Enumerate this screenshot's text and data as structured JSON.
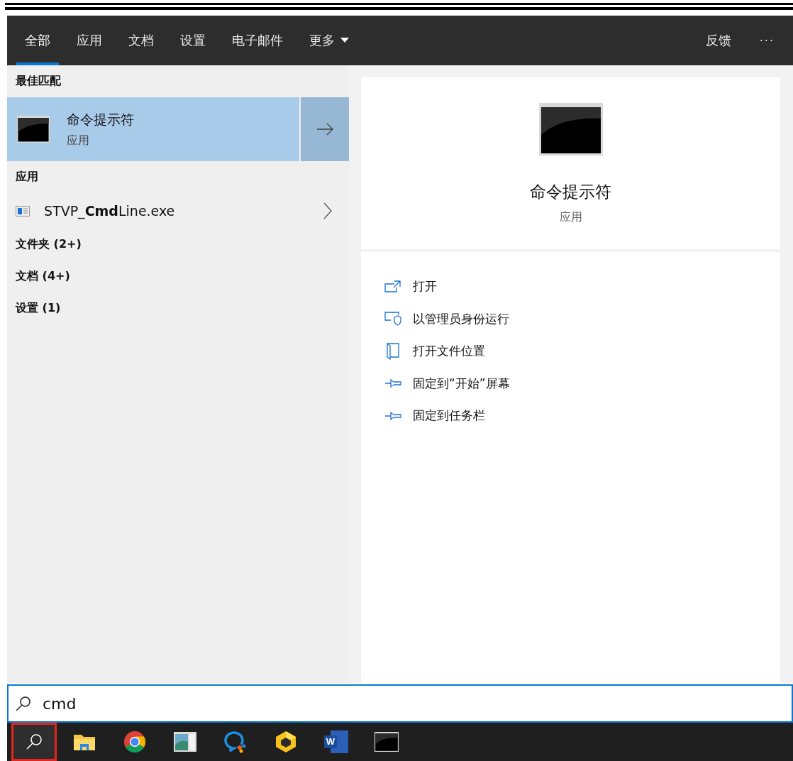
{
  "tabs": [
    {
      "label": "全部",
      "selected": true,
      "dropdown": false
    },
    {
      "label": "应用",
      "selected": false,
      "dropdown": false
    },
    {
      "label": "文档",
      "selected": false,
      "dropdown": false
    },
    {
      "label": "设置",
      "selected": false,
      "dropdown": false
    },
    {
      "label": "电子邮件",
      "selected": false,
      "dropdown": false
    },
    {
      "label": "更多",
      "selected": false,
      "dropdown": true
    }
  ],
  "feedback": "反馈",
  "more_options": "···",
  "results": [
    {
      "heading": "最佳匹配",
      "items": [
        {
          "kind": "best",
          "title": "命令提示符",
          "subtitle": "应用",
          "selected": true
        }
      ]
    },
    {
      "heading": "应用",
      "items": [
        {
          "kind": "app",
          "title": "STVP_**Cmd**Line.exe",
          "selected": false
        }
      ]
    },
    {
      "heading": "文件夹 (2+)"
    },
    {
      "heading": "文档 (4+)"
    },
    {
      "heading": "设置 (1)"
    }
  ],
  "preview": {
    "title": "命令提示符",
    "subtitle": "应用",
    "actions": [
      {
        "kind": "open",
        "label": "打开"
      },
      {
        "kind": "admin",
        "label": "以管理员身份运行"
      },
      {
        "kind": "location",
        "label": "打开文件位置"
      },
      {
        "kind": "pin",
        "label": "固定到“开始”屏幕"
      },
      {
        "kind": "pin",
        "label": "固定到任务栏"
      }
    ]
  },
  "search": {
    "value": "cmd"
  },
  "taskbar": [
    {
      "kind": "search",
      "highlighted": true
    },
    {
      "kind": "folder",
      "highlighted": false
    },
    {
      "kind": "browser",
      "highlighted": false
    },
    {
      "kind": "viewer",
      "highlighted": false
    },
    {
      "kind": "chat",
      "highlighted": false
    },
    {
      "kind": "cube",
      "highlighted": false
    },
    {
      "kind": "word",
      "label": "W",
      "highlighted": false
    },
    {
      "kind": "terminal",
      "highlighted": false
    }
  ]
}
